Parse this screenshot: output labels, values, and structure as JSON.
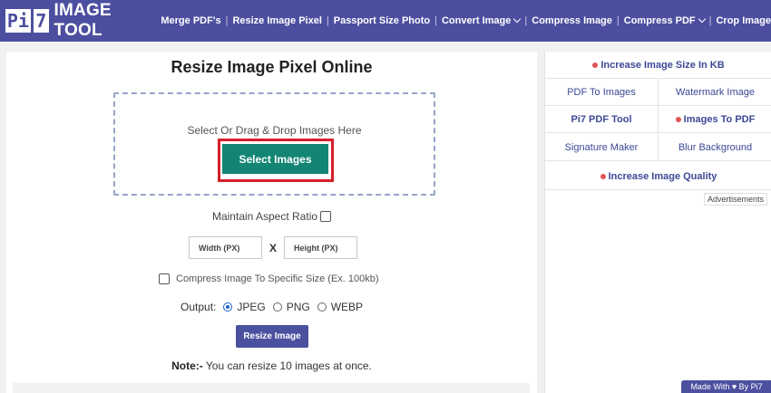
{
  "header": {
    "logo_pi": "Pi",
    "logo_7": "7",
    "logo_text": "IMAGE TOOL",
    "nav": [
      {
        "label": "Merge PDF's",
        "dropdown": false
      },
      {
        "label": "Resize Image Pixel",
        "dropdown": false
      },
      {
        "label": "Passport Size Photo",
        "dropdown": false
      },
      {
        "label": "Convert Image",
        "dropdown": true
      },
      {
        "label": "Compress Image",
        "dropdown": false
      },
      {
        "label": "Compress PDF",
        "dropdown": true
      },
      {
        "label": "Crop Image",
        "dropdown": false
      }
    ],
    "separator": "|"
  },
  "main": {
    "title": "Resize Image Pixel Online",
    "drop_text": "Select Or Drag & Drop Images Here",
    "select_label": "Select Images",
    "aspect_label": "Maintain Aspect Ratio",
    "aspect_checked": false,
    "width_placeholder": "Width (PX)",
    "dim_separator": "X",
    "height_placeholder": "Height (PX)",
    "compress_label": "Compress Image To Specific Size (Ex. 100kb)",
    "compress_checked": false,
    "output_label": "Output:",
    "formats": [
      {
        "label": "JPEG",
        "selected": true
      },
      {
        "label": "PNG",
        "selected": false
      },
      {
        "label": "WEBP",
        "selected": false
      }
    ],
    "resize_label": "Resize Image",
    "note_bold": "Note:-",
    "note_text": " You can resize 10 images at once."
  },
  "sidebar": {
    "tools": {
      "increase_size": "Increase Image Size In KB",
      "pdf_to_images": "PDF To Images",
      "watermark": "Watermark Image",
      "pdf_tool": "Pi7 PDF Tool",
      "images_to_pdf": "Images To PDF",
      "signature": "Signature Maker",
      "blur": "Blur Background",
      "increase_quality": "Increase Image Quality"
    },
    "ads_label": "Advertisements",
    "made_with": "Made With ♥ By  Pi7"
  },
  "colors": {
    "brand": "#4c4f9f",
    "select_button": "#138575",
    "highlight_outline": "#d4202a",
    "dot": "#e05558",
    "link": "#3d4896"
  }
}
